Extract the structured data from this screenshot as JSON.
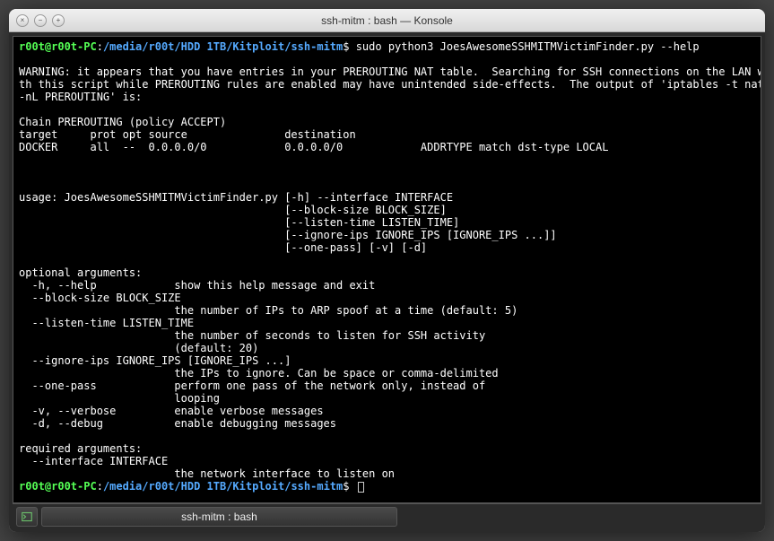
{
  "window": {
    "title": "ssh-mitm : bash — Konsole"
  },
  "prompt": {
    "user_host": "r00t@r00t-PC",
    "colon": ":",
    "path": "/media/r00t/HDD 1TB/Kitploit/ssh-mitm",
    "dollar": "$"
  },
  "command1": " sudo python3 JoesAwesomeSSHMITMVictimFinder.py --help",
  "output_lines": [
    "",
    "WARNING: it appears that you have entries in your PREROUTING NAT table.  Searching for SSH connections on the LAN wi",
    "th this script while PREROUTING rules are enabled may have unintended side-effects.  The output of 'iptables -t nat ",
    "-nL PREROUTING' is:",
    "",
    "Chain PREROUTING (policy ACCEPT)",
    "target     prot opt source               destination         ",
    "DOCKER     all  --  0.0.0.0/0            0.0.0.0/0            ADDRTYPE match dst-type LOCAL",
    "",
    "",
    "",
    "usage: JoesAwesomeSSHMITMVictimFinder.py [-h] --interface INTERFACE",
    "                                         [--block-size BLOCK_SIZE]",
    "                                         [--listen-time LISTEN_TIME]",
    "                                         [--ignore-ips IGNORE_IPS [IGNORE_IPS ...]]",
    "                                         [--one-pass] [-v] [-d]",
    "",
    "optional arguments:",
    "  -h, --help            show this help message and exit",
    "  --block-size BLOCK_SIZE",
    "                        the number of IPs to ARP spoof at a time (default: 5)",
    "  --listen-time LISTEN_TIME",
    "                        the number of seconds to listen for SSH activity",
    "                        (default: 20)",
    "  --ignore-ips IGNORE_IPS [IGNORE_IPS ...]",
    "                        the IPs to ignore. Can be space or comma-delimited",
    "  --one-pass            perform one pass of the network only, instead of",
    "                        looping",
    "  -v, --verbose         enable verbose messages",
    "  -d, --debug           enable debugging messages",
    "",
    "required arguments:",
    "  --interface INTERFACE",
    "                        the network interface to listen on"
  ],
  "command2": " ",
  "tab": {
    "label": "ssh-mitm : bash"
  }
}
